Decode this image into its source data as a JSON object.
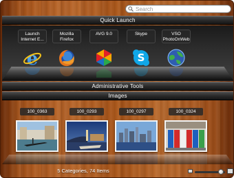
{
  "search": {
    "placeholder": "Search",
    "value": ""
  },
  "sections": {
    "quick_launch": "Quick Launch",
    "admin_tools": "Administrative Tools",
    "images": "Images"
  },
  "quick_launch_items": [
    {
      "label": "Launch Internet E...",
      "icon": "internet-explorer-icon"
    },
    {
      "label": "Mozilla Firefox",
      "icon": "firefox-icon"
    },
    {
      "label": "AVG 9.0",
      "icon": "avg-icon"
    },
    {
      "label": "Skype",
      "icon": "skype-icon"
    },
    {
      "label": "VSO PhotoOnWeb",
      "icon": "photoonweb-icon"
    }
  ],
  "image_items": [
    {
      "label": "100_0363",
      "scene": "venice-canal"
    },
    {
      "label": "100_0293",
      "scene": "harbor-dusk"
    },
    {
      "label": "100_0297",
      "scene": "city-skyline"
    },
    {
      "label": "100_0324",
      "scene": "newspaper-boxes"
    }
  ],
  "status": {
    "text": "5 Categories, 74 Items",
    "icon_size_level": 0.95
  },
  "colors": {
    "wood": "#a9561c",
    "header": "#2a2a2a",
    "text": "#ffffff"
  }
}
